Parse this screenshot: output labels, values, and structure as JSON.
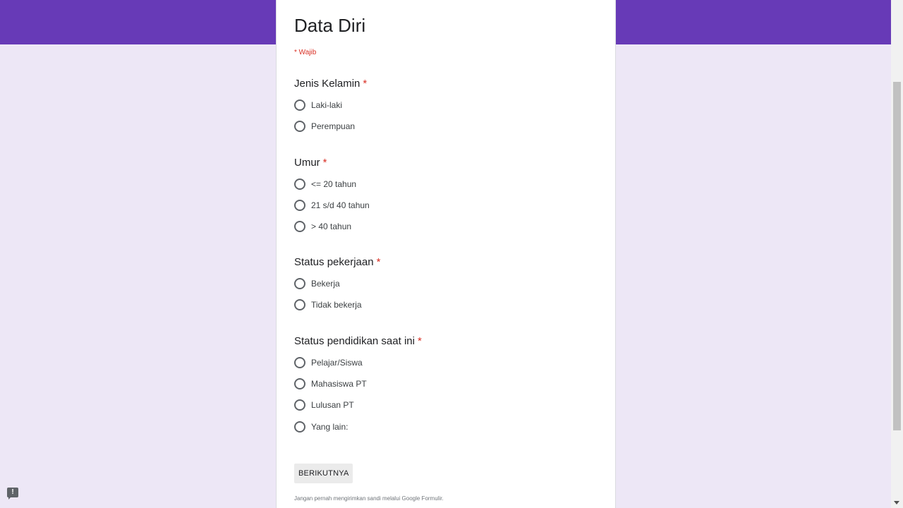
{
  "form": {
    "title": "Data Diri",
    "required_note": "* Wajib",
    "questions": [
      {
        "title": "Jenis Kelamin",
        "required_mark": "*",
        "options": [
          "Laki-laki",
          "Perempuan"
        ]
      },
      {
        "title": "Umur",
        "required_mark": "*",
        "options": [
          "<= 20 tahun",
          "21 s/d 40 tahun",
          "> 40 tahun"
        ]
      },
      {
        "title": "Status pekerjaan",
        "required_mark": "*",
        "options": [
          "Bekerja",
          "Tidak bekerja"
        ]
      },
      {
        "title": "Status pendidikan saat ini",
        "required_mark": "*",
        "options": [
          "Pelajar/Siswa",
          "Mahasiswa PT",
          "Lulusan PT",
          "Yang lain:"
        ]
      }
    ],
    "next_button": "BERIKUTNYA",
    "footer_note": "Jangan pernah mengirimkan sandi melalui Google Formulir."
  },
  "feedback": {
    "icon": "feedback-icon",
    "glyph": "!"
  },
  "colors": {
    "header": "#673ab7",
    "background": "#ede7f6",
    "required": "#d93025"
  }
}
